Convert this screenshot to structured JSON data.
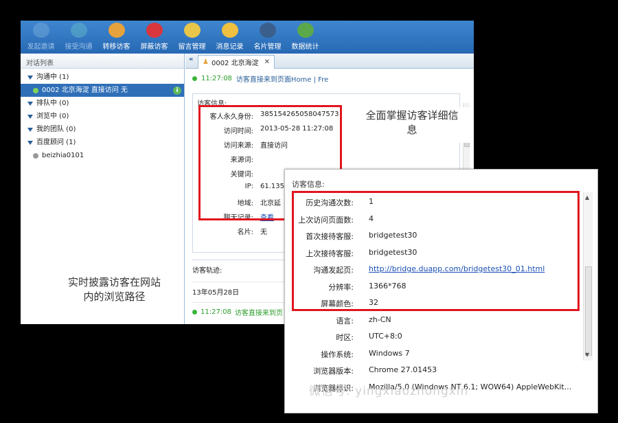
{
  "toolbar": {
    "items": [
      {
        "label": "发起邀请",
        "icon": "bubble-icon",
        "color": "#6fa6d8",
        "enabled": false
      },
      {
        "label": "接受沟通",
        "icon": "chat-check-icon",
        "color": "#5fb3c8",
        "enabled": false
      },
      {
        "label": "转移访客",
        "icon": "user-transfer-icon",
        "color": "#e6a23c",
        "enabled": true
      },
      {
        "label": "屏蔽访客",
        "icon": "block-icon",
        "color": "#d9363e",
        "enabled": true
      },
      {
        "label": "留言管理",
        "icon": "envelope-icon",
        "color": "#e9c54a",
        "enabled": true
      },
      {
        "label": "消息记录",
        "icon": "clock-icon",
        "color": "#f0c040",
        "enabled": true
      },
      {
        "label": "名片管理",
        "icon": "card-icon",
        "color": "#3b5f8c",
        "enabled": true
      },
      {
        "label": "数据统计",
        "icon": "bar-chart-icon",
        "color": "#5aa84a",
        "enabled": true
      }
    ]
  },
  "left": {
    "header": "对话列表",
    "groups": [
      {
        "label": "沟通中 (1)"
      },
      {
        "label": "0002 北京海淀 直接访问 无",
        "selected": true
      },
      {
        "label": "排队中 (0)"
      },
      {
        "label": "浏览中 (0)"
      },
      {
        "label": "我的团队 (0)"
      },
      {
        "label": "百度顾问 (1)"
      },
      {
        "label": "beizhia0101"
      }
    ]
  },
  "tab": {
    "label": "0002 北京海淀",
    "close": "✕"
  },
  "status": {
    "time": "11:27:08",
    "text": "访客直接来到页面Home | Fre"
  },
  "visitor": {
    "title": "访客信息:",
    "rows": [
      {
        "k": "客人永久身份:",
        "v": "385154265058047573"
      },
      {
        "k": "访问时间:",
        "v": "2013-05-28 11:27:08"
      },
      {
        "k": "访问来源:",
        "v": "直接访问"
      },
      {
        "k": "来源词:",
        "v": ""
      },
      {
        "k": "关键词:",
        "v": ""
      },
      {
        "k": "IP:",
        "v": "61.135"
      },
      {
        "k": "地域:",
        "v": "北京延"
      },
      {
        "k": "聊天记录:",
        "v": "查看"
      },
      {
        "k": "名片:",
        "v": "无"
      }
    ]
  },
  "track": {
    "title": "访客轨迹:",
    "date": "13年05月28日",
    "time": "11:27:08",
    "text": "访客直接来到页"
  },
  "callouts": {
    "top": "全面掌握访客详细信息",
    "left": "实时披露访客在网站内的浏览路径"
  },
  "popup": {
    "title": "访客信息:",
    "rows": [
      {
        "k": "历史沟通次数:",
        "v": "1"
      },
      {
        "k": "上次访问页面数:",
        "v": "4"
      },
      {
        "k": "首次接待客服:",
        "v": "bridgetest30"
      },
      {
        "k": "上次接待客服:",
        "v": "bridgetest30"
      },
      {
        "k": "沟通发起页:",
        "v": "http://bridge.duapp.com/bridgetest30_01.html",
        "link": true
      },
      {
        "k": "分辨率:",
        "v": "1366*768"
      },
      {
        "k": "屏幕颜色:",
        "v": "32"
      },
      {
        "k": "语言:",
        "v": "zh-CN"
      },
      {
        "k": "时区:",
        "v": "UTC+8:0"
      },
      {
        "k": "操作系统:",
        "v": "Windows 7"
      },
      {
        "k": "浏览器版本:",
        "v": "Chrome 27.01453"
      },
      {
        "k": "浏览器标识:",
        "v": "Mozilla/5.0 (Windows NT 6.1; WOW64) AppleWebKit..."
      }
    ]
  },
  "watermark": "微信号: yingxiaozhongxin"
}
